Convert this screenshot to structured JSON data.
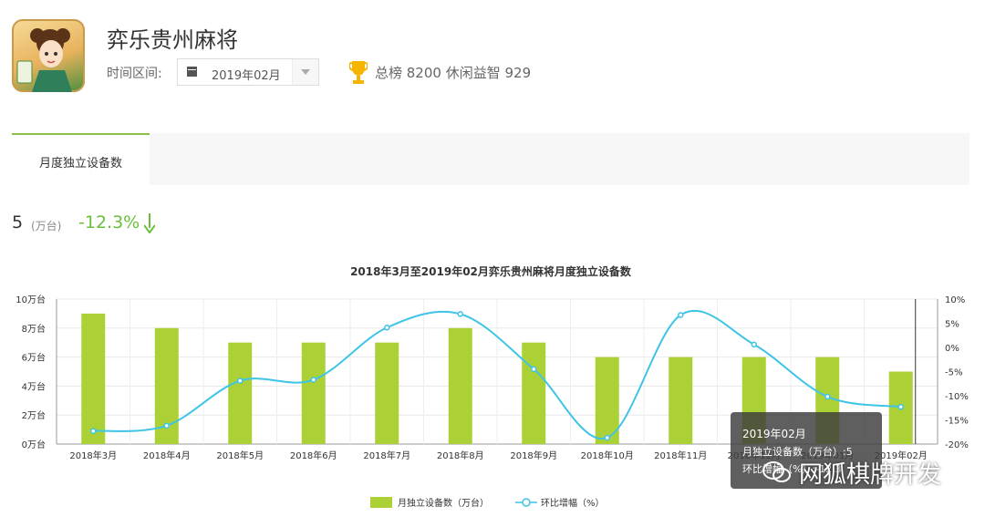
{
  "header": {
    "app_title": "弈乐贵州麻将",
    "range_label": "时间区间:",
    "date_value": "2019年02月",
    "rank_text": "总榜 8200  休闲益智 929"
  },
  "tabs": [
    {
      "label": "月度独立设备数",
      "active": true
    }
  ],
  "summary": {
    "value": "5",
    "unit": "(万台)",
    "change": "-12.3%"
  },
  "chart_data": {
    "type": "bar",
    "title": "2018年3月至2019年02月弈乐贵州麻将月度独立设备数",
    "categories": [
      "2018年3月",
      "2018年4月",
      "2018年5月",
      "2018年6月",
      "2018年7月",
      "2018年8月",
      "2018年9月",
      "2018年10月",
      "2018年11月",
      "2018年12月",
      "2019年01月",
      "2019年02月"
    ],
    "series": [
      {
        "name": "月独立设备数（万台）",
        "type": "bar",
        "color": "#acd136",
        "axis": "left",
        "values": [
          9,
          8,
          7,
          7,
          7,
          8,
          7,
          6,
          6,
          6,
          6,
          5
        ]
      },
      {
        "name": "环比增幅（%）",
        "type": "line",
        "color": "#3ec4e6",
        "axis": "right",
        "values": [
          -17.3,
          -16.2,
          -6.9,
          -6.7,
          4.1,
          6.9,
          -4.5,
          -18.7,
          6.7,
          0.6,
          -10.2,
          -12.3
        ]
      }
    ],
    "y_left": {
      "ticks": [
        "0万台",
        "2万台",
        "4万台",
        "6万台",
        "8万台",
        "10万台"
      ],
      "range": [
        0,
        10
      ]
    },
    "y_right": {
      "ticks": [
        "10%",
        "5%",
        "0%",
        "-5%",
        "-10%",
        "-15%",
        "-20%"
      ],
      "range": [
        -20,
        10
      ]
    },
    "grid": true,
    "legend_position": "bottom",
    "tooltip": {
      "title": "2019年02月",
      "line1": "月独立设备数（万台）:5",
      "line2": "环比增幅（%）:-12.3"
    }
  },
  "watermark": "网狐棋牌开发"
}
